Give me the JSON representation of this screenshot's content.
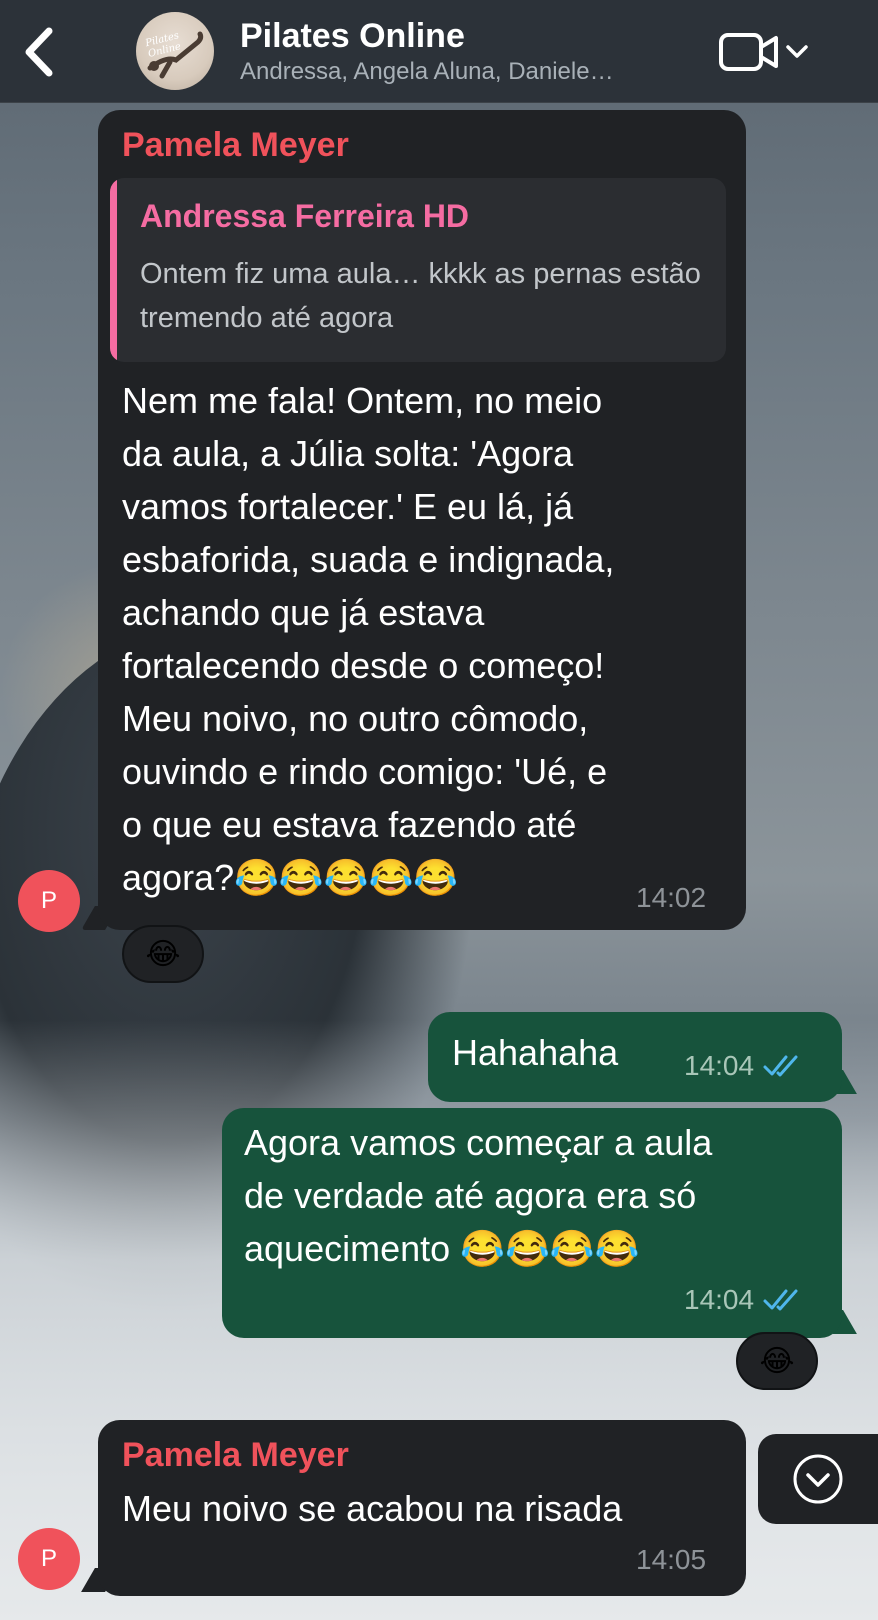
{
  "header": {
    "title": "Pilates Online",
    "members": "Andressa, Angela Aluna, Daniele…",
    "avatar_text": "Pilates Online"
  },
  "messages": [
    {
      "sender": "Pamela Meyer",
      "quote_sender": "Andressa Ferreira HD",
      "quote_text": "Ontem fiz uma aula… kkkk as pernas estão tremendo até agora",
      "lines": [
        "Nem me fala! Ontem, no meio",
        "da aula, a Júlia solta: 'Agora",
        "vamos fortalecer.' E eu lá, já",
        "esbaforida, suada e indignada,",
        "achando que já estava",
        "fortalecendo desde o começo!",
        "Meu noivo, no outro cômodo,",
        "ouvindo e rindo comigo: 'Ué, e",
        "o que eu estava fazendo até",
        "agora?😂😂😂😂😂"
      ],
      "time": "14:02",
      "reaction": "😂",
      "avatar_letter": "P"
    },
    {
      "text": "Hahahaha",
      "time": "14:04"
    },
    {
      "lines": [
        "Agora vamos começar a aula",
        "de verdade até agora era só",
        "aquecimento 😂😂😂😂"
      ],
      "time": "14:04",
      "reaction": "😂"
    },
    {
      "sender": "Pamela Meyer",
      "text": "Meu noivo se acabou na risada",
      "time": "14:05",
      "avatar_letter": "P"
    }
  ],
  "colors": {
    "incoming_bubble": "#202225",
    "outgoing_bubble": "#17533c",
    "sender_name": "#f0525b",
    "quote_accent": "#f56ca2",
    "read_ticks": "#4fb6ec"
  },
  "icons": {
    "back": "chevron-left-icon",
    "video": "video-camera-icon",
    "dropdown": "chevron-down-icon",
    "read": "double-check-icon",
    "scroll": "chevron-down-circle-icon"
  }
}
